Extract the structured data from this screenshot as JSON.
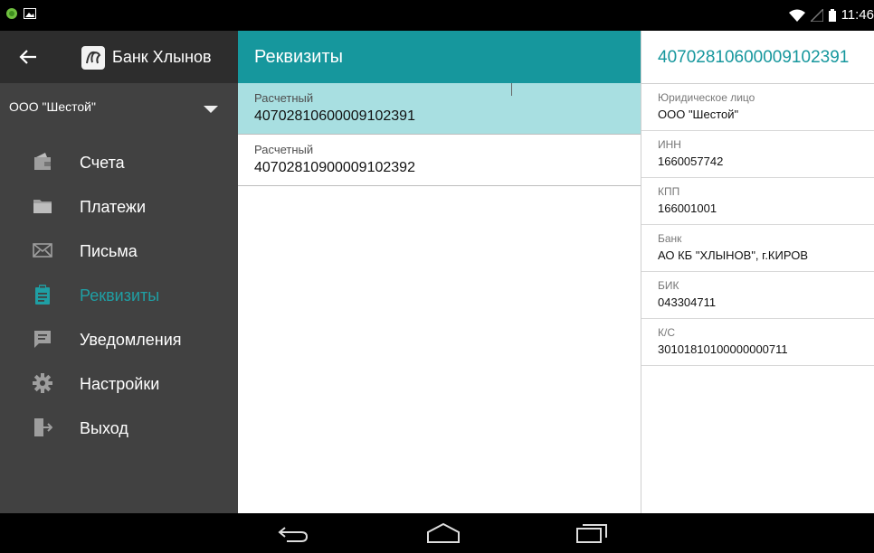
{
  "status_bar": {
    "time": "11:46",
    "left_icons": [
      "app-notification-icon",
      "image-notification-icon"
    ],
    "right_icons": [
      "wifi-icon",
      "signal-icon",
      "battery-icon"
    ]
  },
  "drawer": {
    "bank_name": "Банк Хлынов",
    "organization": "ООО \"Шестой\"",
    "items": [
      {
        "label": "Счета",
        "icon": "wallet-icon"
      },
      {
        "label": "Платежи",
        "icon": "folder-icon"
      },
      {
        "label": "Письма",
        "icon": "mail-icon"
      },
      {
        "label": "Реквизиты",
        "icon": "clipboard-icon",
        "active": true
      },
      {
        "label": "Уведомления",
        "icon": "message-icon"
      },
      {
        "label": "Настройки",
        "icon": "gear-icon"
      },
      {
        "label": "Выход",
        "icon": "exit-icon"
      }
    ]
  },
  "middle": {
    "title": "Реквизиты",
    "accounts": [
      {
        "type": "Расчетный",
        "number": "40702810600009102391",
        "selected": true
      },
      {
        "type": "Расчетный",
        "number": "40702810900009102392",
        "selected": false
      }
    ]
  },
  "details": {
    "title": "40702810600009102391",
    "fields": [
      {
        "label": "Юридическое лицо",
        "value": "ООО \"Шестой\""
      },
      {
        "label": "ИНН",
        "value": "1660057742"
      },
      {
        "label": "КПП",
        "value": "166001001"
      },
      {
        "label": "Банк",
        "value": "АО КБ \"ХЛЫНОВ\", г.КИРОВ"
      },
      {
        "label": "БИК",
        "value": "043304711"
      },
      {
        "label": "К/С",
        "value": "30101810100000000711"
      }
    ]
  },
  "colors": {
    "accent": "#16979d",
    "selected_row": "#a8dfe1",
    "drawer_bg": "#414141",
    "drawer_header_bg": "#2d2d2d"
  }
}
